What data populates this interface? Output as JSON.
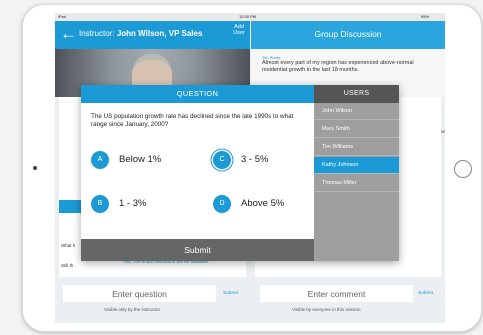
{
  "status": {
    "carrier": "iPad",
    "time": "12:30 PM",
    "battery": "95%"
  },
  "header": {
    "instructor_prefix": "Instructor:",
    "instructor_name": "John Wilson, VP Sales",
    "add_user": "Add User",
    "group_title": "Group Discussion"
  },
  "chat": {
    "name": "Tim Porter",
    "message": "Almost every part of my region has experienced above-normal residential growth in the last 18 months.",
    "ve_text": "ve"
  },
  "background": {
    "what_text": "What h",
    "will_text": "Will th",
    "answer_text": "Yes. The entire discussion will be available."
  },
  "question_modal": {
    "header": "QUESTION",
    "text": "The US population growth rate has declined since the late 1990s to what range since January, 2000?",
    "options": [
      {
        "letter": "A",
        "label": "Below 1%"
      },
      {
        "letter": "B",
        "label": "1 - 3%"
      },
      {
        "letter": "C",
        "label": "3 - 5%"
      },
      {
        "letter": "D",
        "label": "Above 5%"
      }
    ],
    "selected": "C",
    "submit": "Submit"
  },
  "users_panel": {
    "header": "USERS",
    "users": [
      "John Wilson",
      "Mary Smith",
      "Tim Williams",
      "Kathy Johnson",
      "Thomas Miller"
    ],
    "active_user": "Kathy Johnson"
  },
  "bottom": {
    "question_placeholder": "Enter question",
    "question_submit": "Submit",
    "question_hint": "Visible only by the instructor",
    "comment_placeholder": "Enter comment",
    "comment_submit": "Submit",
    "comment_hint": "Visible by everyone in this session"
  },
  "colors": {
    "accent": "#1c9ad6",
    "submit_bar": "#666666",
    "users_bg": "#9e9e9e"
  }
}
